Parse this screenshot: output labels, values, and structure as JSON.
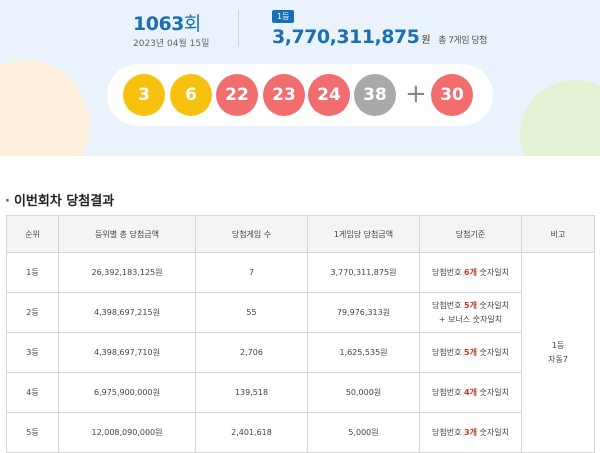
{
  "header": {
    "round_number": "1063",
    "round_suffix": "회",
    "date": "2023년 04월 15일",
    "rank_badge": "1등",
    "prize_amount": "3,770,311,875",
    "prize_unit": "원",
    "winner_summary": "총 7게임 당첨"
  },
  "balls": [
    {
      "number": "3",
      "color": "#f6c20f"
    },
    {
      "number": "6",
      "color": "#f6c20f"
    },
    {
      "number": "22",
      "color": "#f26d6d"
    },
    {
      "number": "23",
      "color": "#f26d6d"
    },
    {
      "number": "24",
      "color": "#f26d6d"
    },
    {
      "number": "38",
      "color": "#a9a9a9"
    }
  ],
  "plus_sign": "+",
  "bonus_ball": {
    "number": "30",
    "color": "#f26d6d"
  },
  "section_title": "이번회차 당첨결과",
  "table": {
    "headers": [
      "순위",
      "등위별 총 당첨금액",
      "당첨게임 수",
      "1게임당 당첨금액",
      "당첨기준",
      "비고"
    ],
    "rows": [
      {
        "rank": "1등",
        "total": "26,392,183,125원",
        "games": "7",
        "per_game": "3,770,311,875원",
        "criteria_pre": "당첨번호 ",
        "criteria_hl": "6개",
        "criteria_post": " 숫자일치",
        "criteria_line2": ""
      },
      {
        "rank": "2등",
        "total": "4,398,697,215원",
        "games": "55",
        "per_game": "79,976,313원",
        "criteria_pre": "당첨번호 ",
        "criteria_hl": "5개",
        "criteria_post": " 숫자일치",
        "criteria_line2": "+ 보너스 숫자일치"
      },
      {
        "rank": "3등",
        "total": "4,398,697,710원",
        "games": "2,706",
        "per_game": "1,625,535원",
        "criteria_pre": "당첨번호 ",
        "criteria_hl": "5개",
        "criteria_post": " 숫자일치",
        "criteria_line2": ""
      },
      {
        "rank": "4등",
        "total": "6,975,900,000원",
        "games": "139,518",
        "per_game": "50,000원",
        "criteria_pre": "당첨번호 ",
        "criteria_hl": "4개",
        "criteria_post": " 숫자일치",
        "criteria_line2": ""
      },
      {
        "rank": "5등",
        "total": "12,008,090,000원",
        "games": "2,401,618",
        "per_game": "5,000원",
        "criteria_pre": "당첨번호 ",
        "criteria_hl": "3개",
        "criteria_post": " 숫자일치",
        "criteria_line2": ""
      }
    ],
    "remark_line1": "1등",
    "remark_line2": "자동7"
  }
}
